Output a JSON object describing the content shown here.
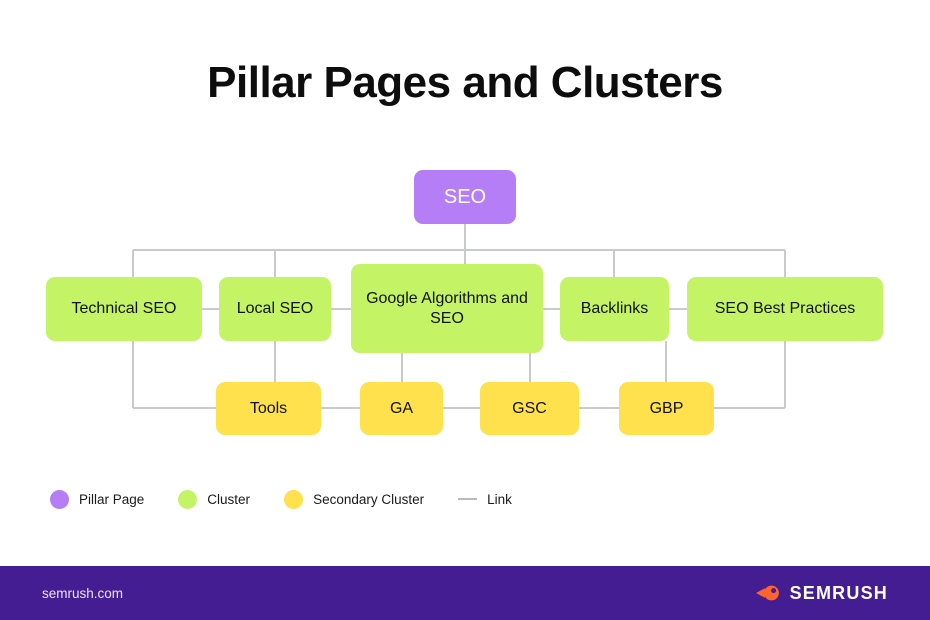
{
  "page": {
    "title": "Pillar Pages and Clusters",
    "background": "#ffffff"
  },
  "colors": {
    "pillar": "#b57ef7",
    "cluster": "#c4f466",
    "secondary": "#ffe04d",
    "link": "#c9c9d0",
    "footer_bg": "#451d93",
    "logo_orange": "#ff642d",
    "text": "#111111"
  },
  "diagram": {
    "pillar": {
      "label": "SEO"
    },
    "clusters": [
      {
        "label": "Technical SEO"
      },
      {
        "label": "Local SEO"
      },
      {
        "label": "Google Algorithms and SEO"
      },
      {
        "label": "Backlinks"
      },
      {
        "label": "SEO Best Practices"
      }
    ],
    "secondary_clusters": [
      {
        "label": "Tools"
      },
      {
        "label": "GA"
      },
      {
        "label": "GSC"
      },
      {
        "label": "GBP"
      }
    ]
  },
  "legend": {
    "items": [
      {
        "label": "Pillar Page",
        "marker": "dot",
        "color": "#b57ef7"
      },
      {
        "label": "Cluster",
        "marker": "dot",
        "color": "#c4f466"
      },
      {
        "label": "Secondary Cluster",
        "marker": "dot",
        "color": "#ffe04d"
      },
      {
        "label": "Link",
        "marker": "line",
        "color": "#b9b9c0"
      }
    ]
  },
  "footer": {
    "url": "semrush.com",
    "brand": "SEMRUSH",
    "logo_icon": "semrush-comet-icon"
  }
}
